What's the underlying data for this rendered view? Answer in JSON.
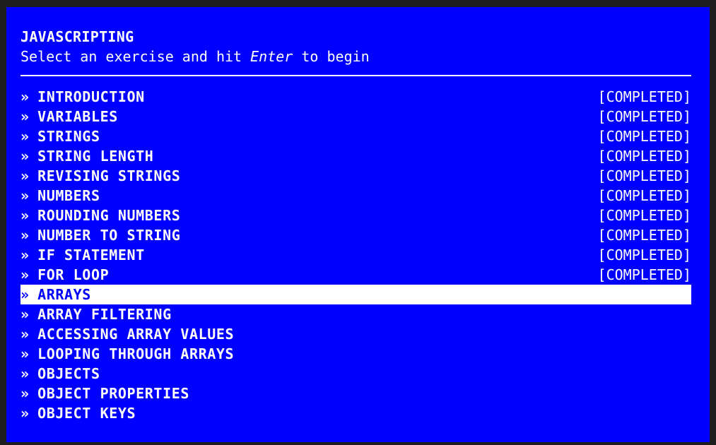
{
  "header": {
    "title": "JAVASCRIPTING",
    "subtitle_before": "Select an exercise and hit ",
    "subtitle_key": "Enter",
    "subtitle_after": " to begin"
  },
  "colors": {
    "background": "#0000ff",
    "text": "#ffffff",
    "selected_background": "#ffffff",
    "selected_text": "#0000ff"
  },
  "bullet": "»",
  "selected_index": 10,
  "exercises": [
    {
      "label": "INTRODUCTION",
      "status": "[COMPLETED]"
    },
    {
      "label": "VARIABLES",
      "status": "[COMPLETED]"
    },
    {
      "label": "STRINGS",
      "status": "[COMPLETED]"
    },
    {
      "label": "STRING LENGTH",
      "status": "[COMPLETED]"
    },
    {
      "label": "REVISING STRINGS",
      "status": "[COMPLETED]"
    },
    {
      "label": "NUMBERS",
      "status": "[COMPLETED]"
    },
    {
      "label": "ROUNDING NUMBERS",
      "status": "[COMPLETED]"
    },
    {
      "label": "NUMBER TO STRING",
      "status": "[COMPLETED]"
    },
    {
      "label": "IF STATEMENT",
      "status": "[COMPLETED]"
    },
    {
      "label": "FOR LOOP",
      "status": "[COMPLETED]"
    },
    {
      "label": "ARRAYS",
      "status": ""
    },
    {
      "label": "ARRAY FILTERING",
      "status": ""
    },
    {
      "label": "ACCESSING ARRAY VALUES",
      "status": ""
    },
    {
      "label": "LOOPING THROUGH ARRAYS",
      "status": ""
    },
    {
      "label": "OBJECTS",
      "status": ""
    },
    {
      "label": "OBJECT PROPERTIES",
      "status": ""
    },
    {
      "label": "OBJECT KEYS",
      "status": ""
    }
  ]
}
